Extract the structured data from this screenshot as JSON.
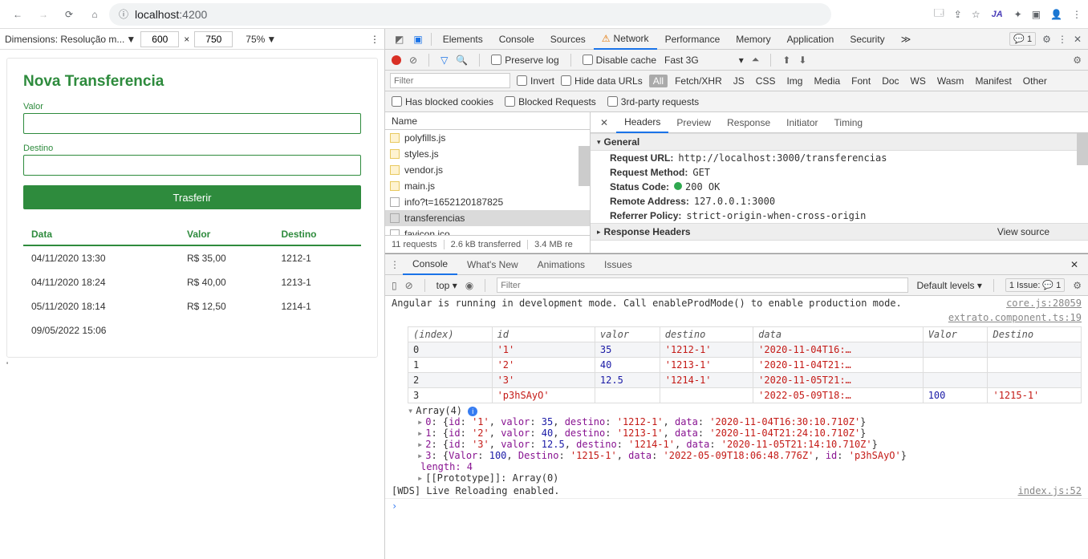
{
  "browser": {
    "url_prefix": "localhost",
    "url_suffix": ":4200",
    "ja": "JA"
  },
  "device_bar": {
    "label": "Dimensions: Resolução m...",
    "w": "600",
    "x": "×",
    "h": "750",
    "zoom": "75%"
  },
  "app": {
    "title": "Nova Transferencia",
    "valor_label": "Valor",
    "destino_label": "Destino",
    "button": "Trasferir",
    "headers": {
      "data": "Data",
      "valor": "Valor",
      "destino": "Destino"
    },
    "rows": [
      {
        "data": "04/11/2020 13:30",
        "valor": "R$ 35,00",
        "destino": "1212-1"
      },
      {
        "data": "04/11/2020 18:24",
        "valor": "R$ 40,00",
        "destino": "1213-1"
      },
      {
        "data": "05/11/2020 18:14",
        "valor": "R$ 12,50",
        "destino": "1214-1"
      },
      {
        "data": "09/05/2022 15:06",
        "valor": "",
        "destino": ""
      }
    ]
  },
  "devtools": {
    "tabs": [
      "Elements",
      "Console",
      "Sources",
      "Network",
      "Performance",
      "Memory",
      "Application",
      "Security"
    ],
    "active_tab": "Network",
    "issues_right": "1",
    "net_toolbar": {
      "preserve": "Preserve log",
      "disable_cache": "Disable cache",
      "throttle": "Fast 3G"
    },
    "filter_placeholder": "Filter",
    "filter_checks": {
      "invert": "Invert",
      "hide": "Hide data URLs"
    },
    "types": [
      "All",
      "Fetch/XHR",
      "JS",
      "CSS",
      "Img",
      "Media",
      "Font",
      "Doc",
      "WS",
      "Wasm",
      "Manifest",
      "Other"
    ],
    "row2": {
      "blocked_cookies": "Has blocked cookies",
      "blocked_req": "Blocked Requests",
      "third": "3rd-party requests"
    },
    "name_header": "Name",
    "requests": [
      {
        "name": "polyfills.js",
        "type": "js"
      },
      {
        "name": "styles.js",
        "type": "js"
      },
      {
        "name": "vendor.js",
        "type": "js"
      },
      {
        "name": "main.js",
        "type": "js"
      },
      {
        "name": "info?t=1652120187825",
        "type": "other"
      },
      {
        "name": "transferencias",
        "type": "other",
        "selected": true
      },
      {
        "name": "favicon.ico",
        "type": "other"
      }
    ],
    "status": {
      "reqs": "11 requests",
      "xfer": "2.6 kB transferred",
      "res": "3.4 MB re"
    },
    "detail_tabs": [
      "Headers",
      "Preview",
      "Response",
      "Initiator",
      "Timing"
    ],
    "general_label": "General",
    "general": [
      {
        "k": "Request URL:",
        "v": "http://localhost:3000/transferencias"
      },
      {
        "k": "Request Method:",
        "v": "GET"
      },
      {
        "k": "Status Code:",
        "v": "200 OK",
        "dot": true
      },
      {
        "k": "Remote Address:",
        "v": "127.0.0.1:3000"
      },
      {
        "k": "Referrer Policy:",
        "v": "strict-origin-when-cross-origin"
      }
    ],
    "resp_headers": "Response Headers",
    "view_source": "View source"
  },
  "console": {
    "tabs": [
      "Console",
      "What's New",
      "Animations",
      "Issues"
    ],
    "top": "top",
    "levels": "Default levels",
    "issue_label": "1 Issue:",
    "issue_count": "1",
    "line1": "Angular is running in development mode. Call enableProdMode() to enable production mode.",
    "src1": "core.js:28059",
    "src2": "extrato.component.ts:19",
    "theaders": [
      "(index)",
      "id",
      "valor",
      "destino",
      "data",
      "Valor",
      "Destino"
    ],
    "trows": [
      [
        "0",
        "'1'",
        "35",
        "'1212-1'",
        "'2020-11-04T16:…",
        "",
        ""
      ],
      [
        "1",
        "'2'",
        "40",
        "'1213-1'",
        "'2020-11-04T21:…",
        "",
        ""
      ],
      [
        "2",
        "'3'",
        "12.5",
        "'1214-1'",
        "'2020-11-05T21:…",
        "",
        ""
      ],
      [
        "3",
        "'p3hSAyO'",
        "",
        "",
        "'2022-05-09T18:…",
        "100",
        "'1215-1'"
      ]
    ],
    "array_label": "Array(4)",
    "objs": [
      "0: {id: '1', valor: 35, destino: '1212-1', data: '2020-11-04T16:30:10.710Z'}",
      "1: {id: '2', valor: 40, destino: '1213-1', data: '2020-11-04T21:24:10.710Z'}",
      "2: {id: '3', valor: 12.5, destino: '1214-1', data: '2020-11-05T21:14:10.710Z'}",
      "3: {Valor: 100, Destino: '1215-1', data: '2022-05-09T18:06:48.776Z', id: 'p3hSAyO'}"
    ],
    "length": "length: 4",
    "proto": "[[Prototype]]: Array(0)",
    "wds": "[WDS] Live Reloading enabled.",
    "src3": "index.js:52"
  }
}
